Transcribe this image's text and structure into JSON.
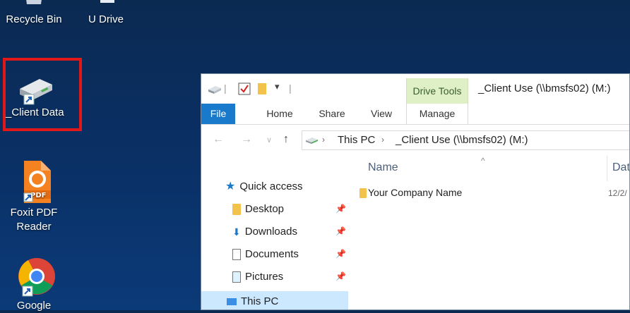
{
  "desktop": {
    "icons": [
      {
        "label": "Recycle Bin"
      },
      {
        "label": "U Drive"
      },
      {
        "label": "_Client  Data"
      },
      {
        "label": "Foxit PDF Reader"
      },
      {
        "label": "Google"
      }
    ],
    "highlight_color": "#e01818"
  },
  "explorer": {
    "contextual_tab": "Drive Tools",
    "window_title": "_Client Use (\\\\bmsfs02) (M:)",
    "tabs": [
      "File",
      "Home",
      "Share",
      "View",
      "Manage"
    ],
    "address": {
      "crumbs": [
        "This PC",
        "_Client Use (\\\\bmsfs02) (M:)"
      ]
    },
    "navpane": {
      "quick_access": "Quick access",
      "items": [
        "Desktop",
        "Downloads",
        "Documents",
        "Pictures"
      ],
      "this_pc": "This PC"
    },
    "content": {
      "columns": [
        "Name",
        "Dat"
      ],
      "rows": [
        {
          "name": "Your Company Name",
          "date": "12/2/"
        }
      ]
    },
    "colors": {
      "file_tab": "#1979ca",
      "drive_tools_bg": "#dff0c6",
      "selection": "#cce8ff"
    }
  }
}
